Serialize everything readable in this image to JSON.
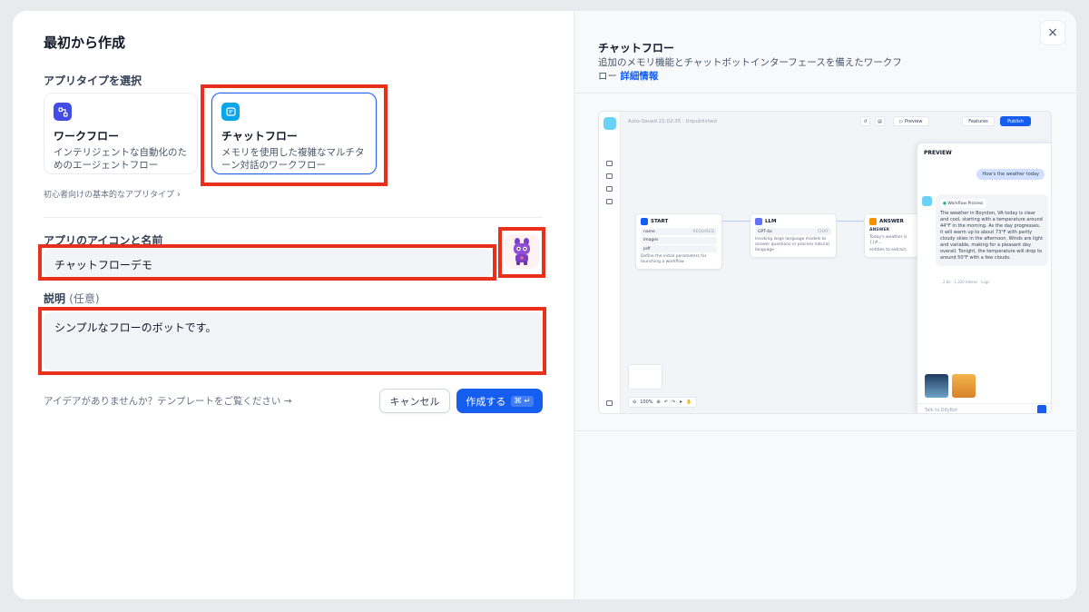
{
  "dialog": {
    "title": "最初から作成",
    "app_type_label": "アプリタイプを選択",
    "app_types": [
      {
        "name": "ワークフロー",
        "desc": "インテリジェントな自動化のためのエージェントフロー",
        "color": "#444ce7"
      },
      {
        "name": "チャットフロー",
        "desc": "メモリを使用した複雑なマルチターン対話のワークフロー",
        "color": "#0ba5ec"
      }
    ],
    "beginner_hint": "初心者向けの基本的なアプリタイプ",
    "name_label": "アプリのアイコンと名前",
    "name_value": "チャットフローデモ",
    "desc_label": "説明",
    "desc_optional": "(任意)",
    "desc_value": "シンプルなフローのボットです。",
    "idea_link": "アイデアがありませんか？テンプレートをご覧ください",
    "cancel_label": "キャンセル",
    "create_label": "作成する",
    "create_shortcut": "⌘ ↵"
  },
  "preview": {
    "title": "チャットフロー",
    "desc": "追加のメモリ機能とチャットボットインターフェースを備えたワークフロー",
    "more_link": "詳細情報",
    "topbar_status": "Auto-Saved 21:02:35 · Unpublished",
    "preview_btn": "Preview",
    "features_btn": "Features",
    "publish_btn": "Publish",
    "zoom": "100%",
    "nodes": {
      "start": {
        "title": "START",
        "rows": [
          "name",
          "images",
          "pdf"
        ],
        "required": "REQUIRED",
        "text": "Define the initial parameters for launching a workflow"
      },
      "llm": {
        "title": "LLM",
        "model": "GPT-4o",
        "mode": "CHAT",
        "text": "Invoking large language models to answer questions or process natural language"
      },
      "answer": {
        "title": "ANSWER",
        "label": "ANSWER",
        "text": "Today's weather is {{#...",
        "sub": "entities to extract."
      }
    },
    "chat": {
      "title": "PREVIEW",
      "question": "How's the weather today",
      "workflow_process": "Workflow Process",
      "answer": "The weather in Boynton, VA today is clear and cool, starting with a temperature around 44°F in the morning. As the day progresses, it will warm up to about 73°F with partly cloudy skies in the afternoon. Winds are light and variable, making for a pleasant day overall. Tonight, the temperature will drop to around 50°F with a few clouds.",
      "meta": "2.8s · 1,320 tokens",
      "logs": "Logs",
      "input_placeholder": "Talk to DifyBot"
    }
  },
  "close_icon": "×",
  "colors": {
    "accent": "#155eef",
    "highlight": "#e8301a"
  }
}
